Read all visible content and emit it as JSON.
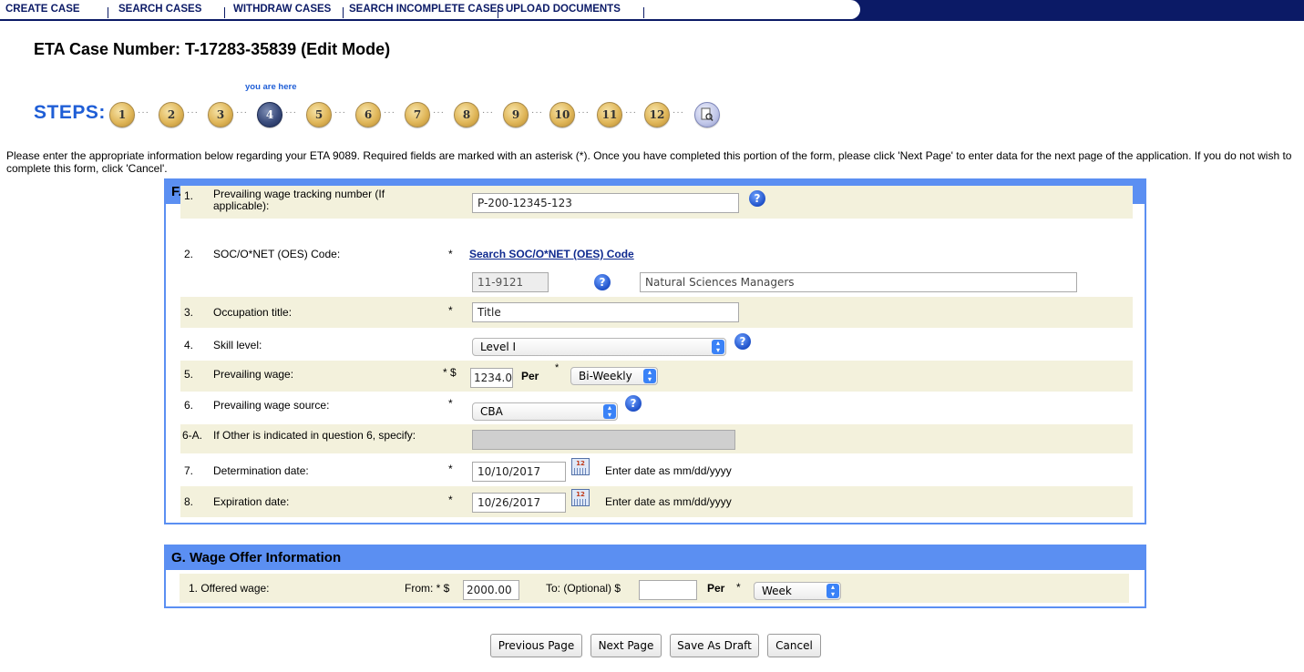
{
  "nav": {
    "items": [
      "CREATE CASE",
      "SEARCH CASES",
      "WITHDRAW CASES",
      "SEARCH INCOMPLETE CASES",
      "UPLOAD DOCUMENTS"
    ]
  },
  "header": {
    "case_title": "ETA Case Number: T-17283-35839  (Edit Mode)"
  },
  "steps": {
    "label": "STEPS:",
    "you_are_here": "you are here",
    "numbers": [
      "1",
      "2",
      "3",
      "4",
      "5",
      "6",
      "7",
      "8",
      "9",
      "10",
      "11",
      "12"
    ],
    "current": "4",
    "review_icon": "review-document-icon"
  },
  "intro": "Please enter the appropriate information below regarding your ETA 9089. Required fields are marked with an asterisk (*). Once you have completed this portion of the form, please click 'Next Page' to enter data for the next page of the application. If you do not wish to complete this form, click 'Cancel'.",
  "section_f": {
    "title": "F. Prevailing Wage Information (as provided by the State Workforce Agency )",
    "q1": {
      "num": "1.",
      "label": "Prevailing wage tracking number (If applicable):",
      "value": "P-200-12345-123"
    },
    "q2": {
      "num": "2.",
      "label": "SOC/O*NET (OES) Code:",
      "star": "*",
      "link": "Search SOC/O*NET (OES) Code",
      "code": "11-9121",
      "code_title": "Natural Sciences Managers"
    },
    "q3": {
      "num": "3.",
      "label": "Occupation title:",
      "star": "*",
      "value": "Title"
    },
    "q4": {
      "num": "4.",
      "label": "Skill level:",
      "value": "Level I"
    },
    "q5": {
      "num": "5.",
      "label": "Prevailing wage:",
      "star": "* $",
      "value": "1234.0",
      "per_label": "Per",
      "per_star": "*",
      "per_value": "Bi-Weekly"
    },
    "q6": {
      "num": "6.",
      "label": "Prevailing wage source:",
      "star": "*",
      "value": "CBA"
    },
    "q6a": {
      "num": "6-A.",
      "label": "If Other is indicated in question 6, specify:",
      "value": ""
    },
    "q7": {
      "num": "7.",
      "label": "Determination date:",
      "star": "*",
      "value": "10/10/2017",
      "hint": "Enter date as mm/dd/yyyy"
    },
    "q8": {
      "num": "8.",
      "label": "Expiration date:",
      "star": "*",
      "value": "10/26/2017",
      "hint": "Enter date as mm/dd/yyyy"
    }
  },
  "section_g": {
    "title": "G. Wage Offer Information",
    "q1": {
      "label": "1.  Offered wage:",
      "from_label": "From: * $",
      "from_value": "2000.00",
      "to_label": "To: (Optional) $",
      "to_value": "",
      "per_label": "Per",
      "per_star": "*",
      "per_value": "Week"
    }
  },
  "buttons": {
    "previous": "Previous Page",
    "next": "Next Page",
    "draft": "Save As Draft",
    "cancel": "Cancel"
  },
  "colors": {
    "nav_bg": "#0b1a66",
    "steps_blue": "#1f5ed6",
    "panel_blue": "#5b8ff2",
    "row_shade": "#f3f1dc"
  }
}
